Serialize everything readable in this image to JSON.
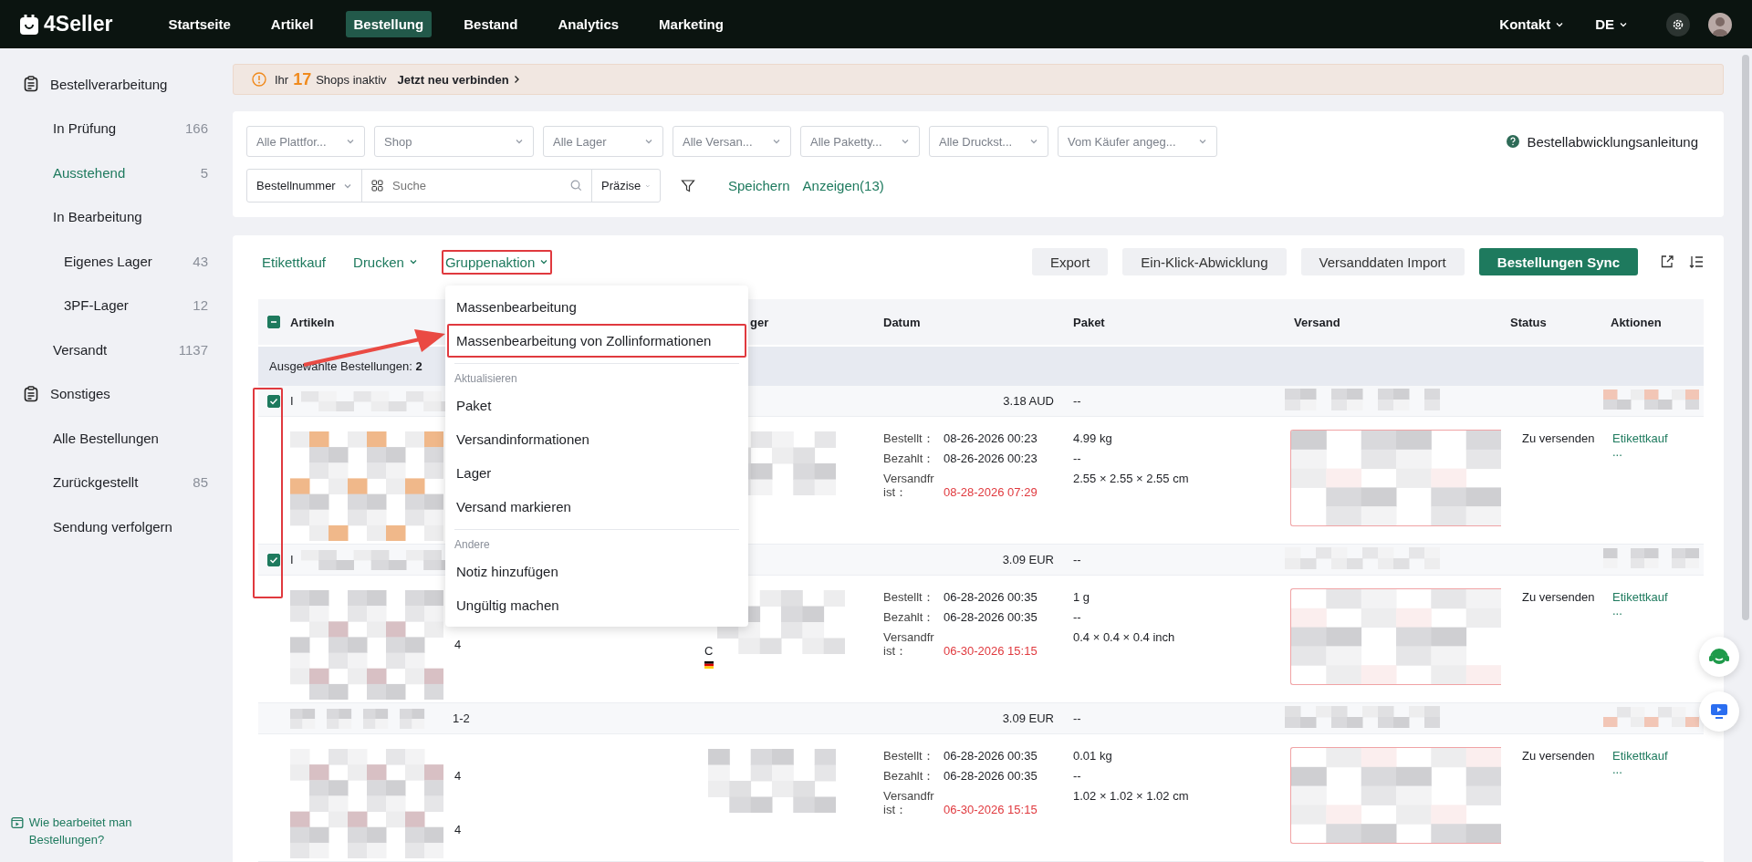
{
  "topbar": {
    "logo": "4Seller",
    "nav": [
      {
        "label": "Startseite",
        "selected": false
      },
      {
        "label": "Artikel",
        "selected": false
      },
      {
        "label": "Bestellung",
        "selected": true
      },
      {
        "label": "Bestand",
        "selected": false
      },
      {
        "label": "Analytics",
        "selected": false
      },
      {
        "label": "Marketing",
        "selected": false
      }
    ],
    "contact": "Kontakt",
    "language": "DE"
  },
  "sidebar": {
    "groups": [
      {
        "title": "Bestellverarbeitung",
        "items": [
          {
            "label": "In Prüfung",
            "count": "166",
            "selected": false
          },
          {
            "label": "Ausstehend",
            "count": "5",
            "selected": true
          },
          {
            "label": "In Bearbeitung",
            "selected": false,
            "children": [
              {
                "label": "Eigenes Lager",
                "count": "43",
                "selected": false
              },
              {
                "label": "3PF-Lager",
                "count": "12",
                "selected": false
              }
            ]
          },
          {
            "label": "Versandt",
            "count": "1137",
            "selected": false
          }
        ]
      },
      {
        "title": "Sonstiges",
        "items": [
          {
            "label": "Alle Bestellungen",
            "selected": false
          },
          {
            "label": "Zurückgestellt",
            "count": "85",
            "selected": false
          },
          {
            "label": "Sendung verfolgern",
            "selected": false
          }
        ]
      }
    ],
    "help": "Wie bearbeitet man Bestellungen?"
  },
  "banner": {
    "prefix": "Ihr",
    "count": "17",
    "suffix": "Shops inaktiv",
    "link": "Jetzt neu verbinden"
  },
  "filters": {
    "selects": [
      "Alle Plattfor...",
      "Shop",
      "Alle Lager",
      "Alle Versan...",
      "Alle Paketty...",
      "Alle Druckst...",
      "Vom Käufer angeg..."
    ],
    "guide": "Bestellabwicklungsanleitung",
    "search_type": "Bestellnummer",
    "search": {
      "placeholder": "Suche"
    },
    "match_mode": "Präzise",
    "save": "Speichern",
    "show": "Anzeigen(13)"
  },
  "toolbar": {
    "actions": [
      {
        "label": "Etikettkauf",
        "dropdown": false,
        "highlighted": false
      },
      {
        "label": "Drucken",
        "dropdown": true,
        "highlighted": false
      },
      {
        "label": "Gruppenaktion",
        "dropdown": true,
        "highlighted": true
      }
    ],
    "buttons": [
      {
        "label": "Export",
        "primary": false
      },
      {
        "label": "Ein-Klick-Abwicklung",
        "primary": false
      },
      {
        "label": "Versanddaten Import",
        "primary": false
      },
      {
        "label": "Bestellungen Sync",
        "primary": true
      }
    ]
  },
  "menu": {
    "entries": [
      {
        "kind": "item",
        "label": "Massenbearbeitung",
        "highlighted": false
      },
      {
        "kind": "item",
        "label": "Massenbearbeitung von Zollinformationen",
        "highlighted": true
      },
      {
        "kind": "section",
        "label": "Aktualisieren"
      },
      {
        "kind": "item",
        "label": "Paket",
        "highlighted": false
      },
      {
        "kind": "item",
        "label": "Versandinformationen",
        "highlighted": false
      },
      {
        "kind": "item",
        "label": "Lager",
        "highlighted": false
      },
      {
        "kind": "item",
        "label": "Versand markieren",
        "highlighted": false
      },
      {
        "kind": "section",
        "label": "Andere"
      },
      {
        "kind": "item",
        "label": "Notiz hinzufügen",
        "highlighted": false
      },
      {
        "kind": "item",
        "label": "Ungültig machen",
        "highlighted": false
      }
    ]
  },
  "table": {
    "select_all_partial": true,
    "columns": [
      "Artikeln",
      "ger",
      "Datum",
      "Paket",
      "Versand",
      "Status",
      "Aktionen"
    ],
    "selection_summary": "Ausgewählte Bestellungen: **2**",
    "orders": [
      {
        "checked": true,
        "header_text": "I",
        "price": "3.18 AUD",
        "package_header": "--",
        "ordered_label": "Bestellt：",
        "ordered": "08-26-2026 00:23",
        "paid_label": "Bezahlt：",
        "paid": "08-26-2026 00:23",
        "deadline_label": "Versandfrist：",
        "deadline": "08-28-2026 07:29",
        "weight": "4.99 kg",
        "dash": "--",
        "dimensions": "2.55 × 2.55 × 2.55 cm",
        "status": "Zu versenden",
        "action": "Etikettkauf",
        "more": "..."
      },
      {
        "checked": true,
        "header_text": "I",
        "price": "3.09 EUR",
        "package_header": "--",
        "item_texts": [
          "4"
        ],
        "warehouse_text": "C",
        "flag": true,
        "ordered_label": "Bestellt：",
        "ordered": "06-28-2026 00:35",
        "paid_label": "Bezahlt：",
        "paid": "06-28-2026 00:35",
        "deadline_label": "Versandfrist：",
        "deadline": "06-30-2026 15:15",
        "weight": "1 g",
        "dash": "--",
        "dimensions": "0.4 × 0.4 × 0.4 inch",
        "status": "Zu versenden",
        "action": "Etikettkauf",
        "more": "..."
      },
      {
        "header_suffix": "1-2",
        "price": "3.09 EUR",
        "package_header": "--",
        "item_texts": [
          "4",
          "4"
        ],
        "ordered_label": "Bestellt：",
        "ordered": "06-28-2026 00:35",
        "paid_label": "Bezahlt：",
        "paid": "06-28-2026 00:35",
        "deadline_label": "Versandfrist：",
        "deadline": "06-30-2026 15:15",
        "weight": "0.01 kg",
        "dash": "--",
        "dimensions": "1.02 × 1.02 × 1.02 cm",
        "status": "Zu versenden",
        "action": "Etikettkauf",
        "more": "..."
      }
    ]
  }
}
